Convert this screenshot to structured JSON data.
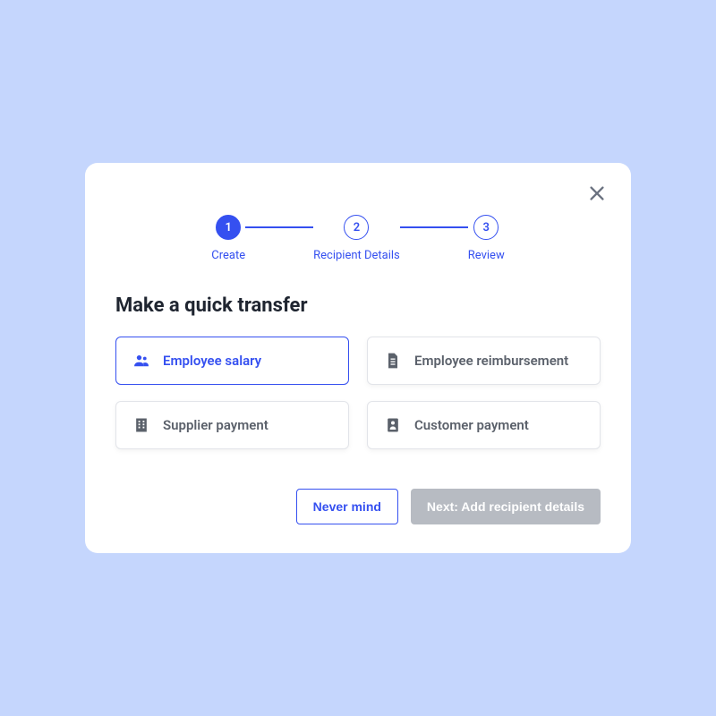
{
  "stepper": {
    "steps": [
      {
        "num": "1",
        "label": "Create",
        "active": true
      },
      {
        "num": "2",
        "label": "Recipient Details",
        "active": false
      },
      {
        "num": "3",
        "label": "Review",
        "active": false
      }
    ]
  },
  "title": "Make a quick transfer",
  "options": {
    "employee_salary": "Employee salary",
    "employee_reimbursement": "Employee reimbursement",
    "supplier_payment": "Supplier payment",
    "customer_payment": "Customer payment"
  },
  "footer": {
    "cancel": "Never mind",
    "next": "Next: Add recipient details"
  }
}
